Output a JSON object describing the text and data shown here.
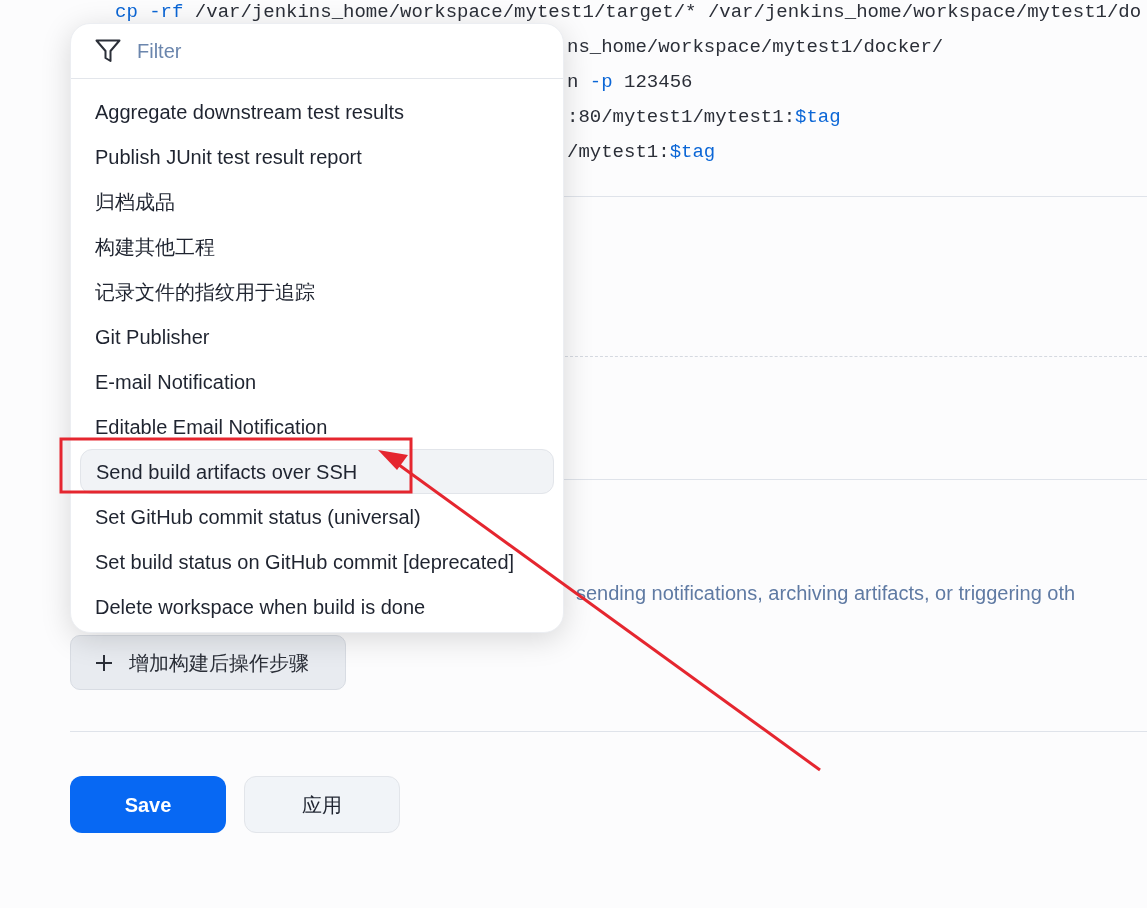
{
  "code_lines": [
    {
      "kind": "full",
      "tokens": [
        {
          "kind": "keyword",
          "text": "cp -rf"
        },
        {
          "kind": "plain",
          "text": " /var/jenkins_home/workspace/mytest1/target/* /var/jenkins_home/workspace/mytest1/do"
        }
      ]
    },
    {
      "kind": "partial",
      "tokens": [
        {
          "kind": "plain",
          "text": "ns_home/workspace/mytest1/docker/"
        }
      ]
    },
    {
      "kind": "partial",
      "tokens": [
        {
          "kind": "plain",
          "text": "n "
        },
        {
          "kind": "keyword",
          "text": "-p"
        },
        {
          "kind": "plain",
          "text": " 123456"
        }
      ]
    },
    {
      "kind": "partial",
      "tokens": [
        {
          "kind": "plain",
          "text": ":80/mytest1/mytest1:"
        },
        {
          "kind": "keyword",
          "text": "$tag"
        }
      ]
    },
    {
      "kind": "partial",
      "tokens": [
        {
          "kind": "plain",
          "text": "/mytest1:"
        },
        {
          "kind": "keyword",
          "text": "$tag"
        }
      ]
    }
  ],
  "help_text": "sending notifications, archiving artifacts, or triggering oth",
  "add_step_button": "增加构建后操作步骤",
  "buttons": [
    {
      "kind": "primary",
      "label": "Save"
    },
    {
      "kind": "secondary",
      "label": "应用"
    }
  ],
  "menu": {
    "filter": {
      "placeholder": "Filter"
    },
    "items": [
      {
        "label": "Aggregate downstream test results",
        "selected": false
      },
      {
        "label": "Publish JUnit test result report",
        "selected": false
      },
      {
        "label": "归档成品",
        "selected": false
      },
      {
        "label": "构建其他工程",
        "selected": false
      },
      {
        "label": "记录文件的指纹用于追踪",
        "selected": false
      },
      {
        "label": "Git Publisher",
        "selected": false
      },
      {
        "label": "E-mail Notification",
        "selected": false
      },
      {
        "label": "Editable Email Notification",
        "selected": false
      },
      {
        "label": "Send build artifacts over SSH",
        "selected": true
      },
      {
        "label": "Set GitHub commit status (universal)",
        "selected": false
      },
      {
        "label": "Set build status on GitHub commit [deprecated]",
        "selected": false
      },
      {
        "label": "Delete workspace when build is done",
        "selected": false
      }
    ]
  }
}
